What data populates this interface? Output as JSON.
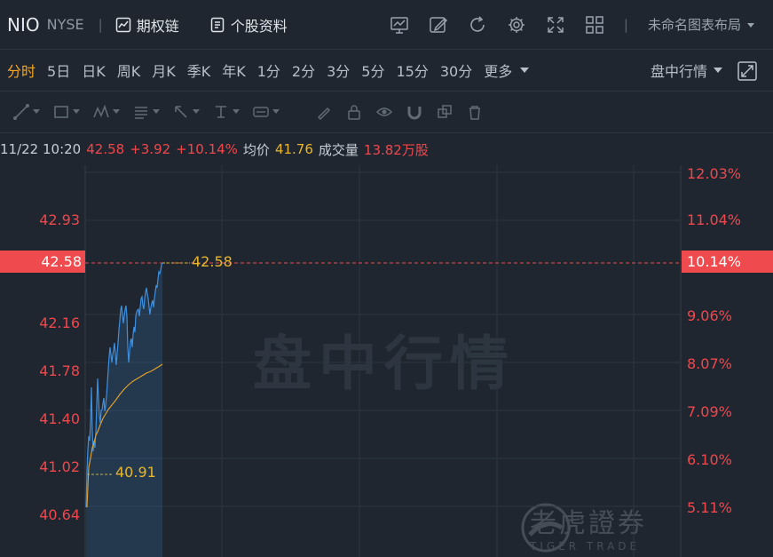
{
  "header": {
    "symbol": "NIO",
    "exchange": "NYSE",
    "separator": "|",
    "options_chain_label": "期权链",
    "stock_profile_label": "个股资料",
    "layout_name": "未命名图表布局",
    "icons": [
      "chart-settings-icon",
      "edit-icon",
      "refresh-icon",
      "gear-icon",
      "fullscreen-icon",
      "grid-layout-icon"
    ]
  },
  "periods": {
    "items": [
      "分时",
      "5日",
      "日K",
      "周K",
      "月K",
      "季K",
      "年K",
      "1分",
      "2分",
      "3分",
      "5分",
      "15分",
      "30分",
      "更多"
    ],
    "active": "分时",
    "session_label": "盘中行情"
  },
  "drawing_tools": [
    "trend-line-icon",
    "rectangle-icon",
    "pattern-icon",
    "fib-icon",
    "arrow-icon",
    "text-icon",
    "price-label-icon",
    "brush-icon",
    "lock-icon",
    "visibility-icon",
    "magnet-icon",
    "clone-icon",
    "trash-icon"
  ],
  "info": {
    "datetime": "11/22 10:20",
    "price": "42.58",
    "change": "+3.92",
    "change_pct": "+10.14%",
    "avg_label": "均价",
    "avg_price": "41.76",
    "volume_label": "成交量",
    "volume": "13.82万股"
  },
  "chart": {
    "watermark": "盘中行情",
    "brand_cn": "老虎證券",
    "brand_en": "TIGER TRADE",
    "left_axis": [
      "42.93",
      "42.58",
      "42.16",
      "41.78",
      "41.40",
      "41.02",
      "40.64"
    ],
    "right_axis": [
      "12.03%",
      "11.04%",
      "10.14%",
      "9.06%",
      "8.07%",
      "7.09%",
      "6.10%",
      "5.11%"
    ],
    "last_price_tag": "42.58",
    "last_pct_tag": "10.14%",
    "last_price_inline": "42.58",
    "open_inline": "40.91",
    "colors": {
      "up": "#f0474d",
      "price_line": "#3d8fe0",
      "avg_line": "#e8a52a",
      "accent": "#f5a623"
    }
  }
}
